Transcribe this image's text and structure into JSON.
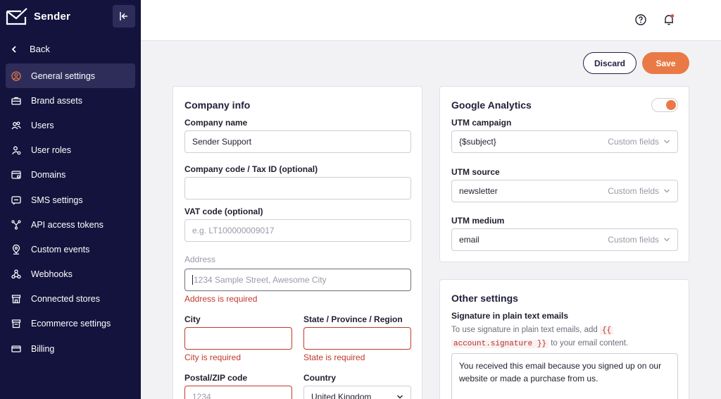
{
  "app": {
    "name": "Sender"
  },
  "sidebar": {
    "back_label": "Back",
    "items": [
      {
        "label": "General settings",
        "icon": "user-circle-icon",
        "active": true
      },
      {
        "label": "Brand assets",
        "icon": "briefcase-icon"
      },
      {
        "label": "Users",
        "icon": "users-icon"
      },
      {
        "label": "User roles",
        "icon": "user-roles-icon"
      },
      {
        "label": "Domains",
        "icon": "domains-icon"
      },
      {
        "label": "SMS settings",
        "icon": "sms-icon"
      },
      {
        "label": "API access tokens",
        "icon": "api-icon"
      },
      {
        "label": "Custom events",
        "icon": "location-pin-icon"
      },
      {
        "label": "Webhooks",
        "icon": "webhook-icon"
      },
      {
        "label": "Connected stores",
        "icon": "store-icon"
      },
      {
        "label": "Ecommerce settings",
        "icon": "ecommerce-icon"
      },
      {
        "label": "Billing",
        "icon": "billing-icon"
      }
    ]
  },
  "actions": {
    "discard": "Discard",
    "save": "Save"
  },
  "company": {
    "title": "Company info",
    "name_label": "Company name",
    "name_value": "Sender Support",
    "code_label": "Company code / Tax ID (optional)",
    "code_value": "",
    "vat_label": "VAT code (optional)",
    "vat_placeholder": "e.g. LT100000009017",
    "address_label": "Address",
    "address_placeholder": "1234 Sample Street, Awesome City",
    "address_error": "Address is required",
    "city_label": "City",
    "city_error": "City is required",
    "state_label": "State / Province / Region",
    "state_error": "State is required",
    "zip_label": "Postal/ZIP code",
    "zip_placeholder": "1234",
    "country_label": "Country",
    "country_value": "United Kingdom"
  },
  "ga": {
    "title": "Google Analytics",
    "enabled": true,
    "campaign_label": "UTM campaign",
    "campaign_value": "{$subject}",
    "source_label": "UTM source",
    "source_value": "newsletter",
    "medium_label": "UTM medium",
    "medium_value": "email",
    "custom_fields": "Custom fields"
  },
  "other": {
    "title": "Other settings",
    "signature_label": "Signature in plain text emails",
    "help_prefix": "To use signature in plain text emails, add",
    "help_code_1": "{{",
    "help_code_2": "account.signature }}",
    "help_suffix": "to your email content.",
    "signature_text": "You received this email because you signed up on our website or made a purchase from us."
  },
  "colors": {
    "sidebar": "#14133d",
    "accent": "#ea7a45",
    "error": "#c0392b"
  }
}
